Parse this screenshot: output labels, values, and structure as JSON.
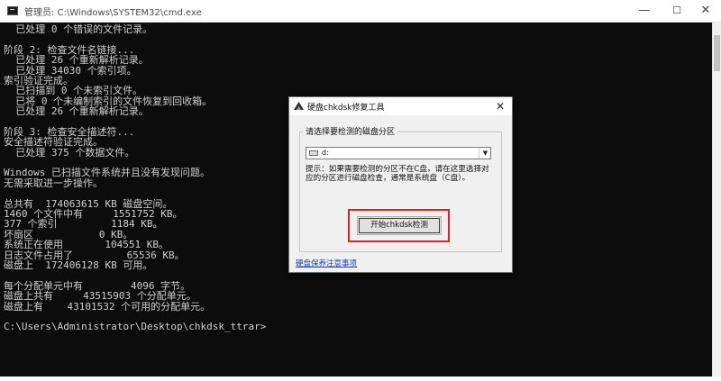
{
  "window": {
    "title": "管理员: C:\\Windows\\SYSTEM32\\cmd.exe",
    "minimize_glyph": "—",
    "maximize_glyph": "☐",
    "close_glyph": "✕"
  },
  "console": {
    "lines": [
      "  已处理 0 个错误的文件记录。",
      "",
      "阶段 2: 检查文件名链接...",
      "  已处理 26 个重新解析记录。",
      "  已处理 34030 个索引项。",
      "索引验证完成。",
      "  已扫描到 0 个未索引文件。",
      "  已将 0 个未编制索引的文件恢复到回收箱。",
      "  已处理 26 个重新解析记录。",
      "",
      "阶段 3: 检查安全描述符...",
      "安全描述符验证完成。",
      "  已处理 375 个数据文件。",
      "",
      "Windows 已扫描文件系统并且没有发现问题。",
      "无需采取进一步操作。",
      "",
      "总共有  174063615 KB 磁盘空间。",
      "1460 个文件中有     1551752 KB。",
      "377 个索引         1184 KB。",
      "坏扇区           0 KB。",
      "系统正在使用       104551 KB。",
      "日志文件占用了         65536 KB。",
      "磁盘上  172406128 KB 可用。",
      "",
      "每个分配单元中有        4096 字节。",
      "磁盘上共有     43515903 个分配单元。",
      "磁盘上有    43101532 个可用的分配单元。",
      "",
      "C:\\Users\\Administrator\\Desktop\\chkdsk_ttrar>"
    ]
  },
  "dialog": {
    "title": "硬盘chkdsk修复工具",
    "close_glyph": "✕",
    "group_label": "请选择要检测的磁盘分区",
    "drive_value": "d:",
    "dropdown_glyph": "▼",
    "hint": "提示：如果需要检测的分区不在C盘，请在这里选择对应的分区进行磁盘检查，通常是系统盘（C盘）。",
    "start_button": "开始chkdsk检测",
    "link": "硬盘保养注意事项"
  },
  "colors": {
    "console_bg": "#0c0c0c",
    "console_text": "#cfcfcf",
    "highlight": "#e02020",
    "link": "#1a3fb8"
  }
}
